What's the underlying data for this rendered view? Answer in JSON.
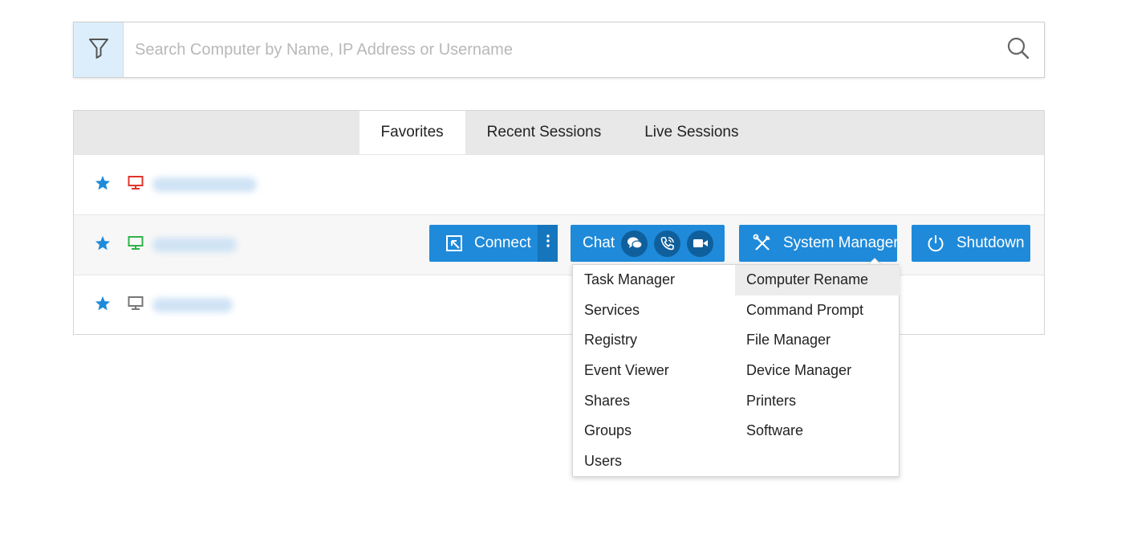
{
  "search": {
    "placeholder": "Search Computer by Name, IP Address or Username",
    "filter_icon": "filter-icon",
    "search_icon": "search-icon"
  },
  "tabs": [
    {
      "label": "Favorites",
      "active": true
    },
    {
      "label": "Recent Sessions",
      "active": false
    },
    {
      "label": "Live Sessions",
      "active": false
    }
  ],
  "rows": [
    {
      "favorite": true,
      "monitor_status_color": "#e0352b",
      "name": ""
    },
    {
      "favorite": true,
      "monitor_status_color": "#2fb34a",
      "name": ""
    },
    {
      "favorite": true,
      "monitor_status_color": "#777777",
      "name": ""
    }
  ],
  "actions": {
    "connect_label": "Connect",
    "chat_label": "Chat",
    "system_manager_label": "System Manager",
    "shutdown_label": "Shutdown"
  },
  "system_manager_menu": {
    "left": [
      "Task Manager",
      "Services",
      "Registry",
      "Event Viewer",
      "Shares",
      "Groups",
      "Users"
    ],
    "right": [
      "Computer Rename",
      "Command Prompt",
      "File Manager",
      "Device Manager",
      "Printers",
      "Software"
    ],
    "highlighted": "Computer Rename"
  },
  "colors": {
    "accent": "#1f8ad9",
    "accent_dark": "#1676bd",
    "star": "#1f8ad9",
    "filter_bg": "#dceefb"
  }
}
